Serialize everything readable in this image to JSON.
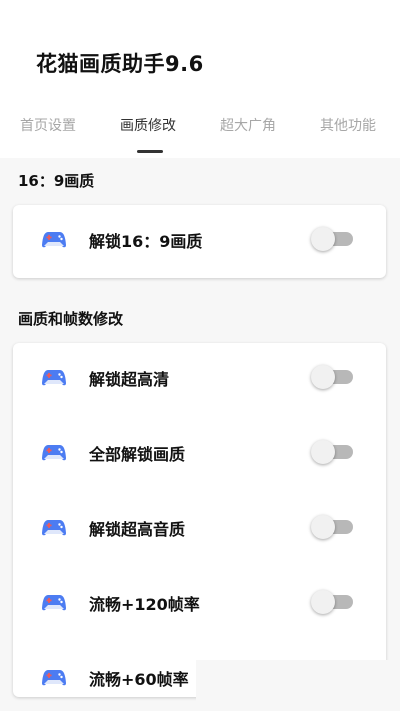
{
  "app": {
    "title": "花猫画质助手9.6"
  },
  "tabs": [
    {
      "label": "首页设置",
      "active": false
    },
    {
      "label": "画质修改",
      "active": true
    },
    {
      "label": "超大广角",
      "active": false
    },
    {
      "label": "其他功能",
      "active": false
    }
  ],
  "sections": [
    {
      "title": "16：9画质",
      "items": [
        {
          "label": "解锁16：9画质",
          "enabled": false,
          "icon": "gamepad-icon"
        }
      ]
    },
    {
      "title": "画质和帧数修改",
      "items": [
        {
          "label": "解锁超高清",
          "enabled": false,
          "icon": "gamepad-icon"
        },
        {
          "label": "全部解锁画质",
          "enabled": false,
          "icon": "gamepad-icon"
        },
        {
          "label": "解锁超高音质",
          "enabled": false,
          "icon": "gamepad-icon"
        },
        {
          "label": "流畅+120帧率",
          "enabled": false,
          "icon": "gamepad-icon"
        },
        {
          "label": "流畅+60帧率",
          "enabled": false,
          "icon": "gamepad-icon"
        }
      ]
    }
  ],
  "colors": {
    "active_tab": "#333333",
    "inactive_tab": "#a7a7a7",
    "toggle_off_track": "#b8b8b8",
    "icon_blue": "#4c7cf2",
    "icon_red": "#f05a5a"
  }
}
